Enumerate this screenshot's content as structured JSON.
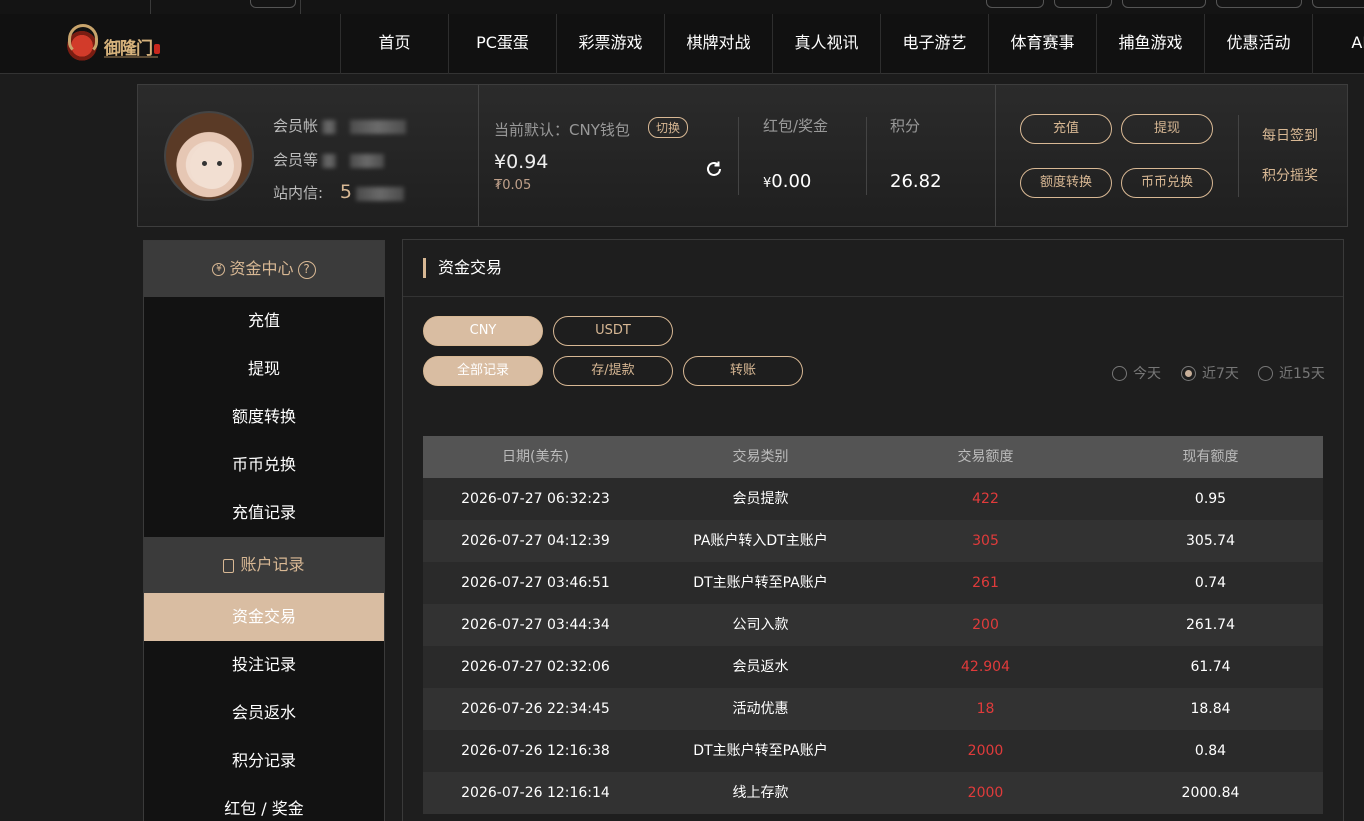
{
  "nav": {
    "logo_text": "御隆门",
    "items": [
      "首页",
      "PC蛋蛋",
      "彩票游戏",
      "棋牌对战",
      "真人视讯",
      "电子游艺",
      "体育赛事",
      "捕鱼游戏",
      "优惠活动",
      "APP"
    ]
  },
  "profile": {
    "account_label": "会员帐",
    "level_label": "会员等",
    "msg_label": "站内信:",
    "msg_count": "5",
    "wallet_label": "当前默认：CNY钱包",
    "switch_label": "切换",
    "wallet_balance": "¥0.94",
    "wallet_sub": "₮0.05",
    "hongbao_label": "红包/奖金",
    "hongbao_currency": "¥",
    "hongbao_value": "0.00",
    "points_label": "积分",
    "points_value": "26.82",
    "buttons": {
      "deposit": "充值",
      "withdraw": "提现",
      "transfer": "额度转换",
      "exchange": "币币兑换"
    },
    "daily_signin": "每日签到",
    "points_lottery": "积分摇奖"
  },
  "sidebar": {
    "fund_center": "资金中心",
    "fund_items": [
      "充值",
      "提现",
      "额度转换",
      "币币兑换",
      "充值记录"
    ],
    "account_records": "账户记录",
    "account_items": [
      "资金交易",
      "投注记录",
      "会员返水",
      "积分记录",
      "红包 / 奖金"
    ]
  },
  "main": {
    "title": "资金交易",
    "currency_tabs": [
      "CNY",
      "USDT"
    ],
    "filter_tabs": [
      "全部记录",
      "存/提款",
      "转账"
    ],
    "radios": [
      "今天",
      "近7天",
      "近15天"
    ],
    "selected_radio": "近7天",
    "columns": [
      "日期(美东)",
      "交易类别",
      "交易额度",
      "现有额度"
    ],
    "rows": [
      [
        "2026-07-27 06:32:23",
        "会员提款",
        "422",
        "0.95"
      ],
      [
        "2026-07-27 04:12:39",
        "PA账户转入DT主账户",
        "305",
        "305.74"
      ],
      [
        "2026-07-27 03:46:51",
        "DT主账户转至PA账户",
        "261",
        "0.74"
      ],
      [
        "2026-07-27 03:44:34",
        "公司入款",
        "200",
        "261.74"
      ],
      [
        "2026-07-27 02:32:06",
        "会员返水",
        "42.904",
        "61.74"
      ],
      [
        "2026-07-26 22:34:45",
        "活动优惠",
        "18",
        "18.84"
      ],
      [
        "2026-07-26 12:16:38",
        "DT主账户转至PA账户",
        "2000",
        "0.84"
      ],
      [
        "2026-07-26 12:16:14",
        "线上存款",
        "2000",
        "2000.84"
      ]
    ]
  },
  "colors": {
    "accent": "#d8b894",
    "active_bg": "#d9bda2",
    "amount_red": "#e03b3b"
  }
}
